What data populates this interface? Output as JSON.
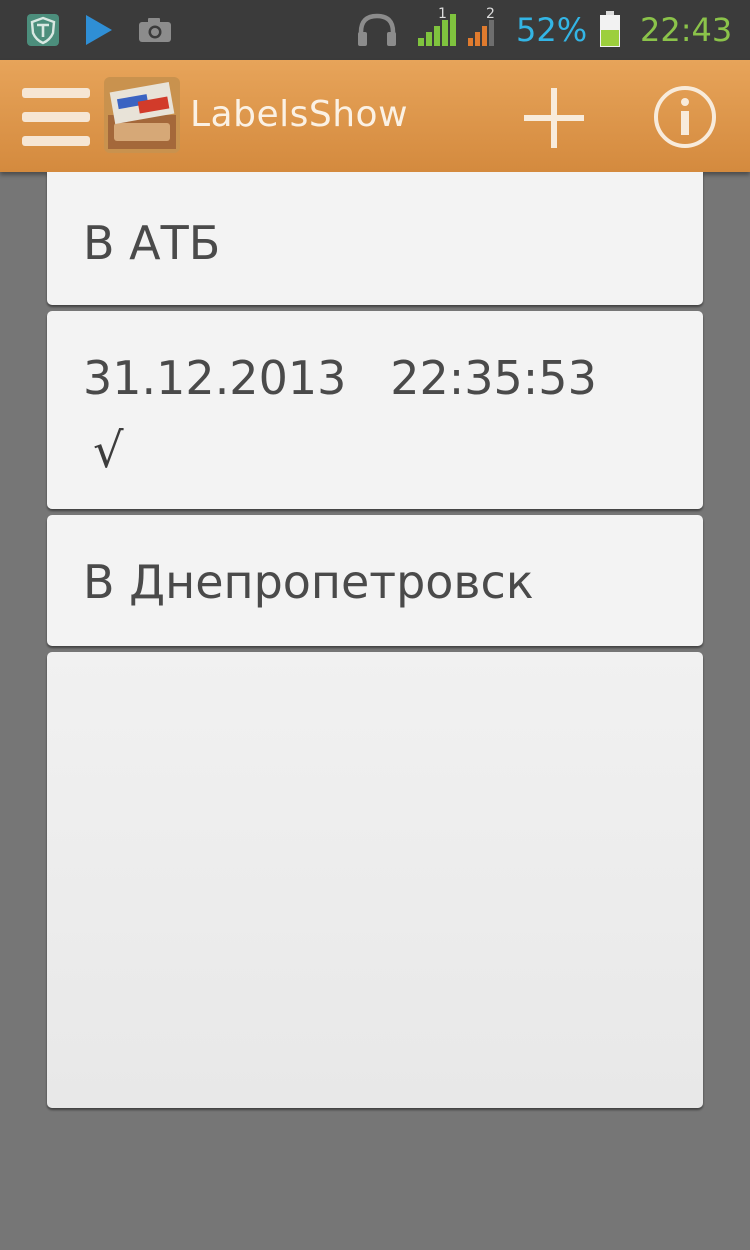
{
  "status_bar": {
    "battery_percent": "52%",
    "time": "22:43",
    "sim1_label": "1",
    "sim2_label": "2",
    "colors": {
      "battery_text": "#33b5e5",
      "time_text": "#8bc34a"
    }
  },
  "action_bar": {
    "app_name": "LabelsShow",
    "background": "#d9923f",
    "icons": [
      "menu-icon",
      "app-logo-icon",
      "add-icon",
      "info-icon"
    ]
  },
  "notes": [
    {
      "text": "В АТБ"
    },
    {
      "text": "31.12.2013   22:35:53",
      "mark": "√"
    },
    {
      "text": "В Днепропетровск"
    }
  ]
}
